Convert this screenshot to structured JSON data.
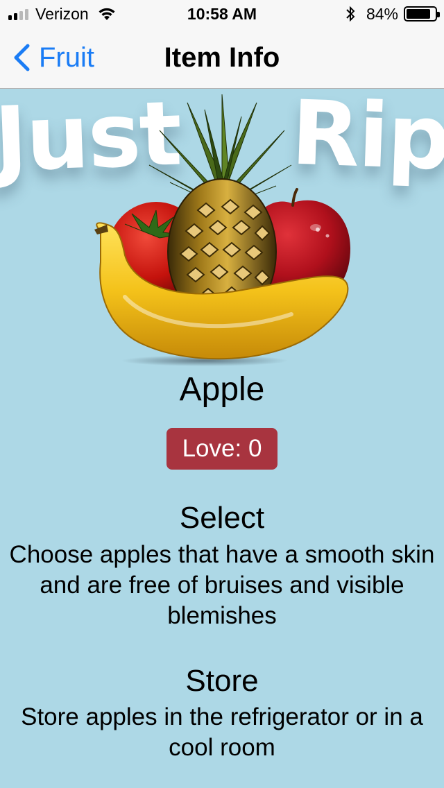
{
  "status_bar": {
    "carrier": "Verizon",
    "time": "10:58 AM",
    "battery_percent": "84%",
    "battery_level": 0.84,
    "signal_bars_filled": 2,
    "signal_bars_total": 4
  },
  "nav": {
    "back_label": "Fruit",
    "title": "Item Info",
    "accent_color": "#1a7cf5"
  },
  "hero": {
    "logo_word_1": "Just",
    "logo_word_2": "Ripe",
    "fruits": [
      "tomato",
      "pineapple",
      "apple",
      "banana"
    ]
  },
  "item": {
    "name": "Apple",
    "love_label": "Love: 0",
    "love_color": "#a8343f"
  },
  "sections": {
    "select": {
      "heading": "Select",
      "body": "Choose apples that have a smooth skin and are free of bruises and visible blemishes"
    },
    "store": {
      "heading": "Store",
      "body": "Store apples in the refrigerator or in a cool room"
    }
  },
  "colors": {
    "background": "#add8e6",
    "bar_background": "#f7f7f7"
  }
}
